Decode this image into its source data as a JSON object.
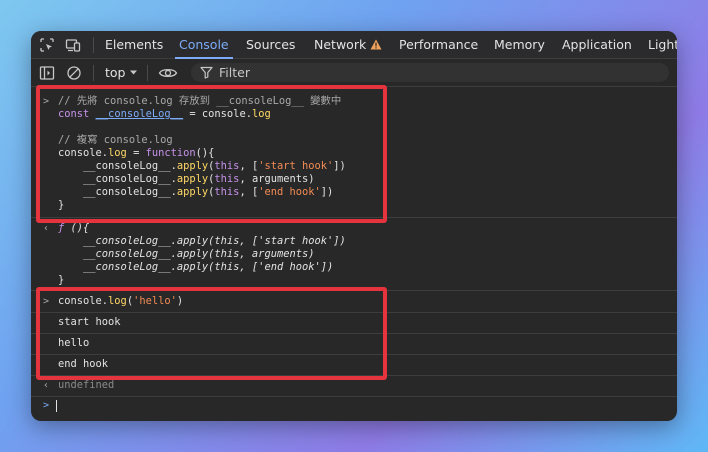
{
  "tabs": [
    {
      "label": "Elements"
    },
    {
      "label": "Console",
      "active": true
    },
    {
      "label": "Sources"
    },
    {
      "label": "Network"
    },
    {
      "label": "Performance"
    },
    {
      "label": "Memory"
    },
    {
      "label": "Application"
    },
    {
      "label": "Light"
    }
  ],
  "toolbar": {
    "context": "top",
    "filter_placeholder": "Filter"
  },
  "entry1": {
    "lines": [
      "// 先將 console.log 存放到 __consoleLog__ 變數中",
      "const __consoleLog__ = console.log",
      "// 複寫 console.log",
      "console.log = function(){",
      "    __consoleLog__.apply(this, ['start hook'])",
      "    __consoleLog__.apply(this, arguments)",
      "    __consoleLog__.apply(this, ['end hook'])",
      "}"
    ]
  },
  "result1": {
    "lines": [
      "f (){",
      "    __consoleLog__.apply(this, ['start hook'])",
      "    __consoleLog__.apply(this, arguments)",
      "    __consoleLog__.apply(this, ['end hook'])",
      "}"
    ]
  },
  "entry2": {
    "command": "console.log('hello')",
    "outputs": [
      "start hook",
      "hello",
      "end hook"
    ],
    "result": "undefined"
  },
  "colors": {
    "highlight": "#e6343f",
    "active_tab": "#7cacf8",
    "string": "#f28b54",
    "keyword": "#c792ea",
    "property": "#ffd866"
  }
}
